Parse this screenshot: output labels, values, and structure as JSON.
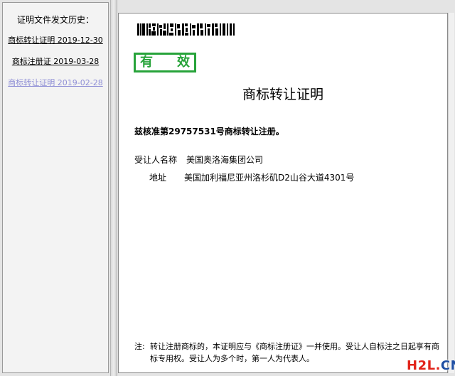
{
  "sidebar": {
    "title": "证明文件发文历史：",
    "links": [
      {
        "label": "商标转让证明  2019-12-30",
        "active": false
      },
      {
        "label": "商标注册证  2019-03-28",
        "active": false
      },
      {
        "label": "商标转让证明  2019-02-28",
        "active": true
      }
    ]
  },
  "document": {
    "stamp": {
      "char1": "有",
      "char2": "效",
      "color": "#27a33a"
    },
    "title": "商标转让证明",
    "approval_text": "兹核准第29757531号商标转让注册。",
    "assignee_label": "受让人名称",
    "assignee_value": "美国奥洛海集团公司",
    "address_label": "地址",
    "address_value": "美国加利福尼亚州洛杉矶D2山谷大道4301号",
    "note_lead": "注:",
    "note_body": "转让注册商标的，本证明应与《商标注册证》一并使用。受让人自标注之日起享有商标专用权。受让人为多个时，第一人为代表人。"
  },
  "watermark": {
    "part1": "H2L",
    "part2": ".",
    "part3": "CN"
  },
  "colors": {
    "active_link": "#8f8fd6",
    "stamp_green": "#27a33a",
    "watermark_red": "#e2231a",
    "watermark_blue": "#1f4fa3"
  }
}
